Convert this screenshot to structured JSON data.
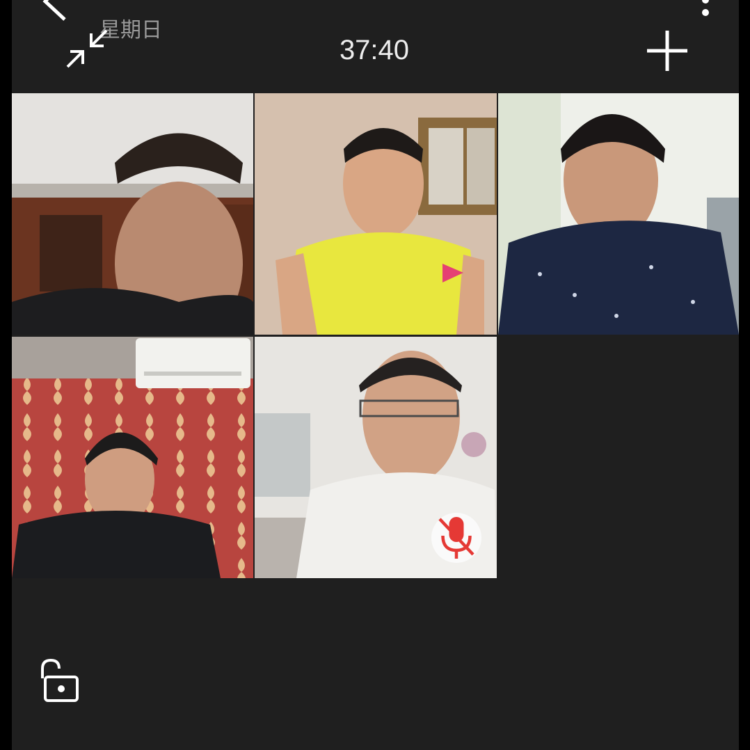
{
  "header": {
    "day_label": "星期日",
    "call_timer": "37:40"
  },
  "icons": {
    "back": "arrow-left-icon",
    "more": "more-vertical-icon",
    "minimize": "minimize-arrows-icon",
    "add": "plus-icon",
    "muted": "mic-off-icon",
    "lock": "unlock-icon"
  },
  "participants": [
    {
      "tile": "participant-1",
      "muted": false
    },
    {
      "tile": "participant-2",
      "muted": false
    },
    {
      "tile": "participant-3",
      "muted": false
    },
    {
      "tile": "participant-4",
      "muted": false
    },
    {
      "tile": "participant-5",
      "muted": true
    }
  ],
  "colors": {
    "background": "#1f1f1f",
    "muted_icon": "#e53935",
    "icon": "#ffffff"
  }
}
